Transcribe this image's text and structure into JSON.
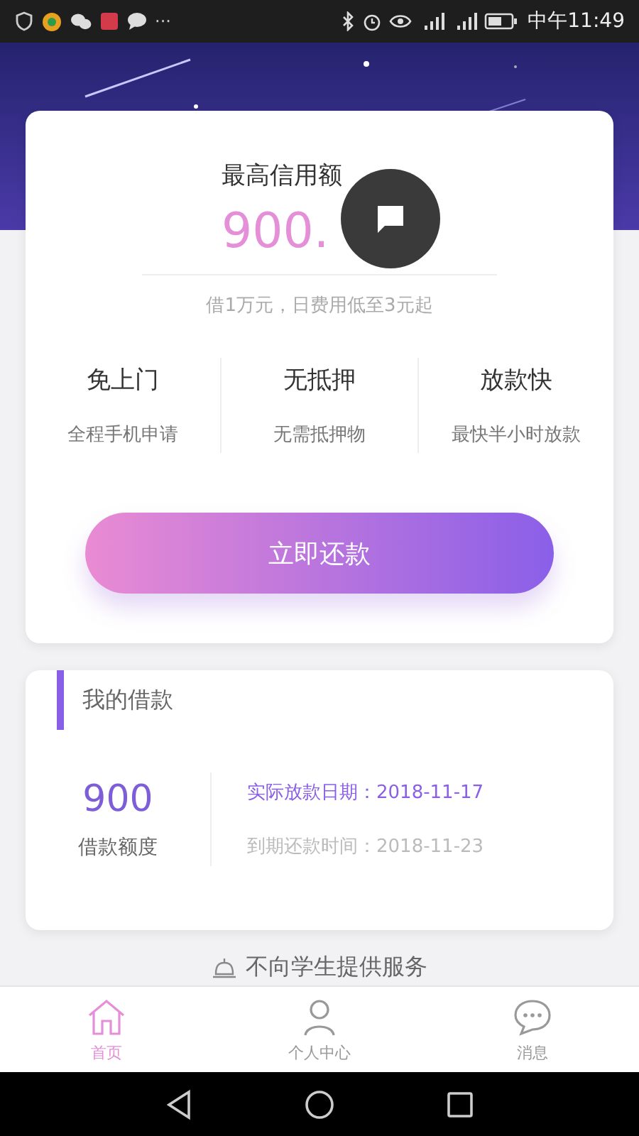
{
  "status_bar": {
    "time": "中午11:49",
    "more": "···"
  },
  "credit_card": {
    "title": "最高信用额",
    "amount": "900.",
    "note": "借1万元，日费用低至3元起",
    "features": [
      {
        "title": "免上门",
        "desc": "全程手机申请"
      },
      {
        "title": "无抵押",
        "desc": "无需抵押物"
      },
      {
        "title": "放款快",
        "desc": "最快半小时放款"
      }
    ],
    "button": "立即还款"
  },
  "loan_card": {
    "title": "我的借款",
    "amount": "900",
    "amount_label": "借款额度",
    "details": [
      {
        "text": "实际放款日期：2018-11-17",
        "kind": "highlight"
      },
      {
        "text": "到期还款时间：2018-11-23",
        "kind": "muted"
      }
    ]
  },
  "notice": "不向学生提供服务",
  "tabs": [
    {
      "label": "首页",
      "selected": true
    },
    {
      "label": "个人中心",
      "selected": false
    },
    {
      "label": "消息",
      "selected": false
    }
  ]
}
